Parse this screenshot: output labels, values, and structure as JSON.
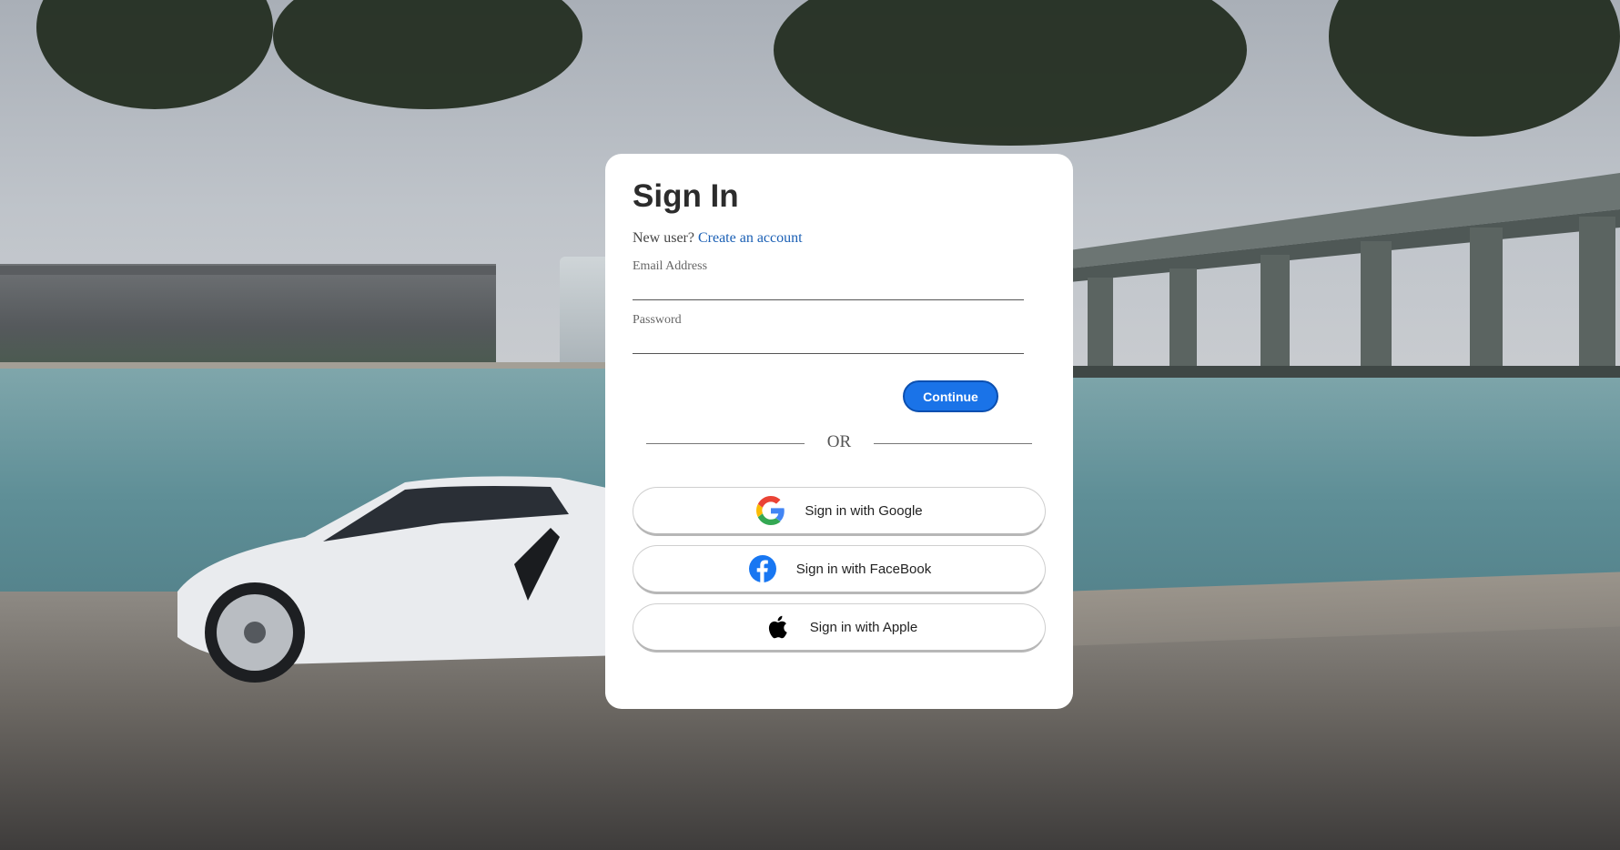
{
  "card": {
    "title": "Sign In",
    "new_user_text": "New user?",
    "create_account_link": "Create an account",
    "email_label": "Email Address",
    "email_value": "",
    "password_label": "Password",
    "password_value": "",
    "continue_label": "Continue",
    "divider_text": "OR"
  },
  "social": [
    {
      "label": "Sign in with Google",
      "icon": "google-icon"
    },
    {
      "label": "Sign in with FaceBook",
      "icon": "facebook-icon"
    },
    {
      "label": "Sign in with Apple",
      "icon": "apple-icon"
    }
  ],
  "colors": {
    "primary": "#1a73e8",
    "link": "#1a5fb4",
    "facebook": "#1877f2"
  }
}
